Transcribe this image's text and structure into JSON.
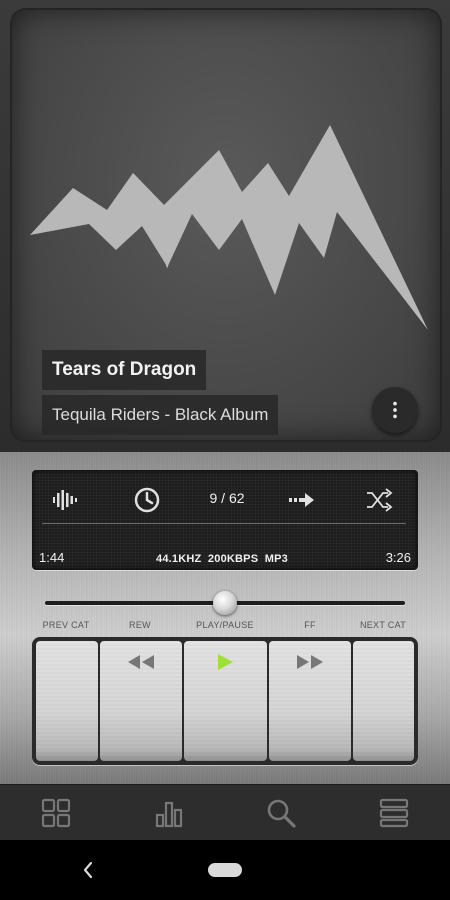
{
  "now_playing": {
    "title": "Tears of Dragon",
    "artist_album": "Tequila Riders - Black Album"
  },
  "status": {
    "track_position": "9 / 62",
    "elapsed": "1:44",
    "total": "3:26",
    "format": "44.1KHZ  200KBPS  MP3",
    "seek_progress": 0.5
  },
  "controls": {
    "prev_cat": "PREV CAT",
    "rew": "REW",
    "play_pause": "PLAY/PAUSE",
    "ff": "FF",
    "next_cat": "NEXT CAT"
  },
  "colors": {
    "play_accent": "#9ee03a",
    "art_foreground": "#b8b8b8"
  },
  "icons": {
    "lcd": [
      "equalizer-icon",
      "sleep-timer-icon",
      "repeat-icon",
      "shuffle-icon"
    ],
    "bottom_nav": [
      "grid-icon",
      "bar-chart-icon",
      "search-icon",
      "list-icon"
    ],
    "menu": "more-vert-icon"
  }
}
